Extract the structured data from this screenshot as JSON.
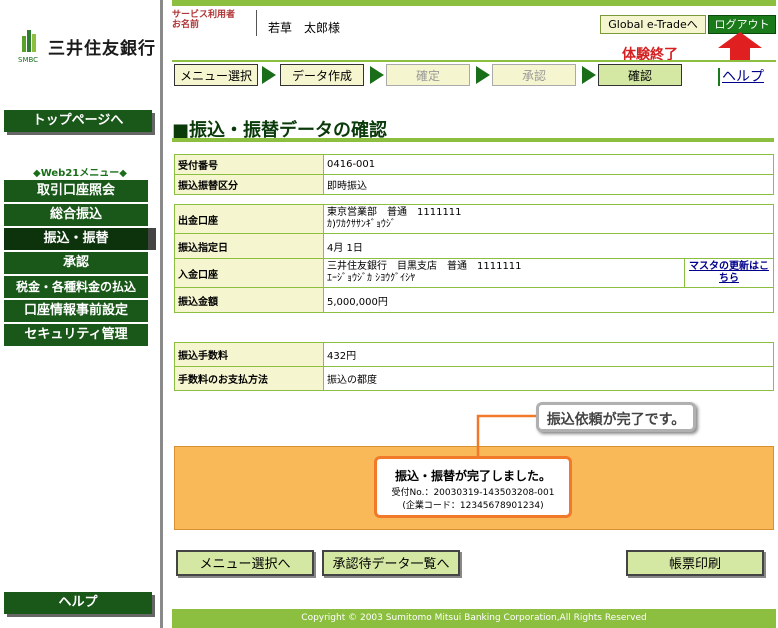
{
  "brand": {
    "name": "三井住友銀行",
    "sub": "SMBC"
  },
  "sidebar": {
    "top_page": "トップページへ",
    "menu_title": "◆Web21メニュー◆",
    "items": [
      {
        "label": "取引口座照会"
      },
      {
        "label": "総合振込"
      },
      {
        "label": "振込・振替"
      },
      {
        "label": "承認"
      },
      {
        "label": "税金・各種料金の払込"
      },
      {
        "label": "口座情報事前設定"
      },
      {
        "label": "セキュリティ管理"
      }
    ],
    "help": "ヘルプ"
  },
  "header": {
    "user_label": "サービス利用者\nお名前",
    "user_name": "若草　太郎様",
    "global_button": "Global e-Tradeへ",
    "logout_button": "ログアウト",
    "taiken": "体験終了"
  },
  "steps": [
    {
      "label": "メニュー選択"
    },
    {
      "label": "データ作成"
    },
    {
      "label": "確定"
    },
    {
      "label": "承認"
    },
    {
      "label": "確認"
    }
  ],
  "help_link": "ヘルプ",
  "page_title": "■振込・振替データの確認",
  "table1": [
    {
      "label": "受付番号",
      "value": "0416-001"
    },
    {
      "label": "振込振替区分",
      "value": "即時振込"
    }
  ],
  "table2": {
    "source_label": "出金口座",
    "source_line1": "東京営業部　普通　1111111",
    "source_line2": "ｶ)ﾜｶｸｻｻﾝｷﾞｮｳｼﾞ",
    "date_label": "振込指定日",
    "date_value": "4月 1日",
    "dest_label": "入金口座",
    "dest_line1": "三井住友銀行　目黒支店　普通　1111111",
    "dest_line2": "ｴｰｼﾞｮｳｼﾞｶ ｼﾖｳｸﾞｲｼﾔ",
    "dest_link": "マスタの更新はこちら",
    "amount_label": "振込金額",
    "amount_value": "5,000,000円"
  },
  "table3": [
    {
      "label": "振込手数料",
      "value": "432円"
    },
    {
      "label": "手数料のお支払方法",
      "value": "振込の都度"
    }
  ],
  "callout": "振込依頼が完了です。",
  "done": {
    "main": "振込・振替が完了しました。",
    "receipt": "受付No.：20030319-143503208-001",
    "corp": "(企業コード：12345678901234)"
  },
  "buttons": {
    "menu": "メニュー選択へ",
    "pending": "承認待データ一覧へ",
    "print": "帳票印刷"
  },
  "footer": "Copyright © 2003 Sumitomo Mitsui Banking Corporation,All Rights Reserved",
  "colors": {
    "green_dark": "#195819",
    "green_light": "#8cbf3f",
    "cream": "#f5f5d0",
    "orange": "#f9b959",
    "alert_red": "#d42020"
  }
}
